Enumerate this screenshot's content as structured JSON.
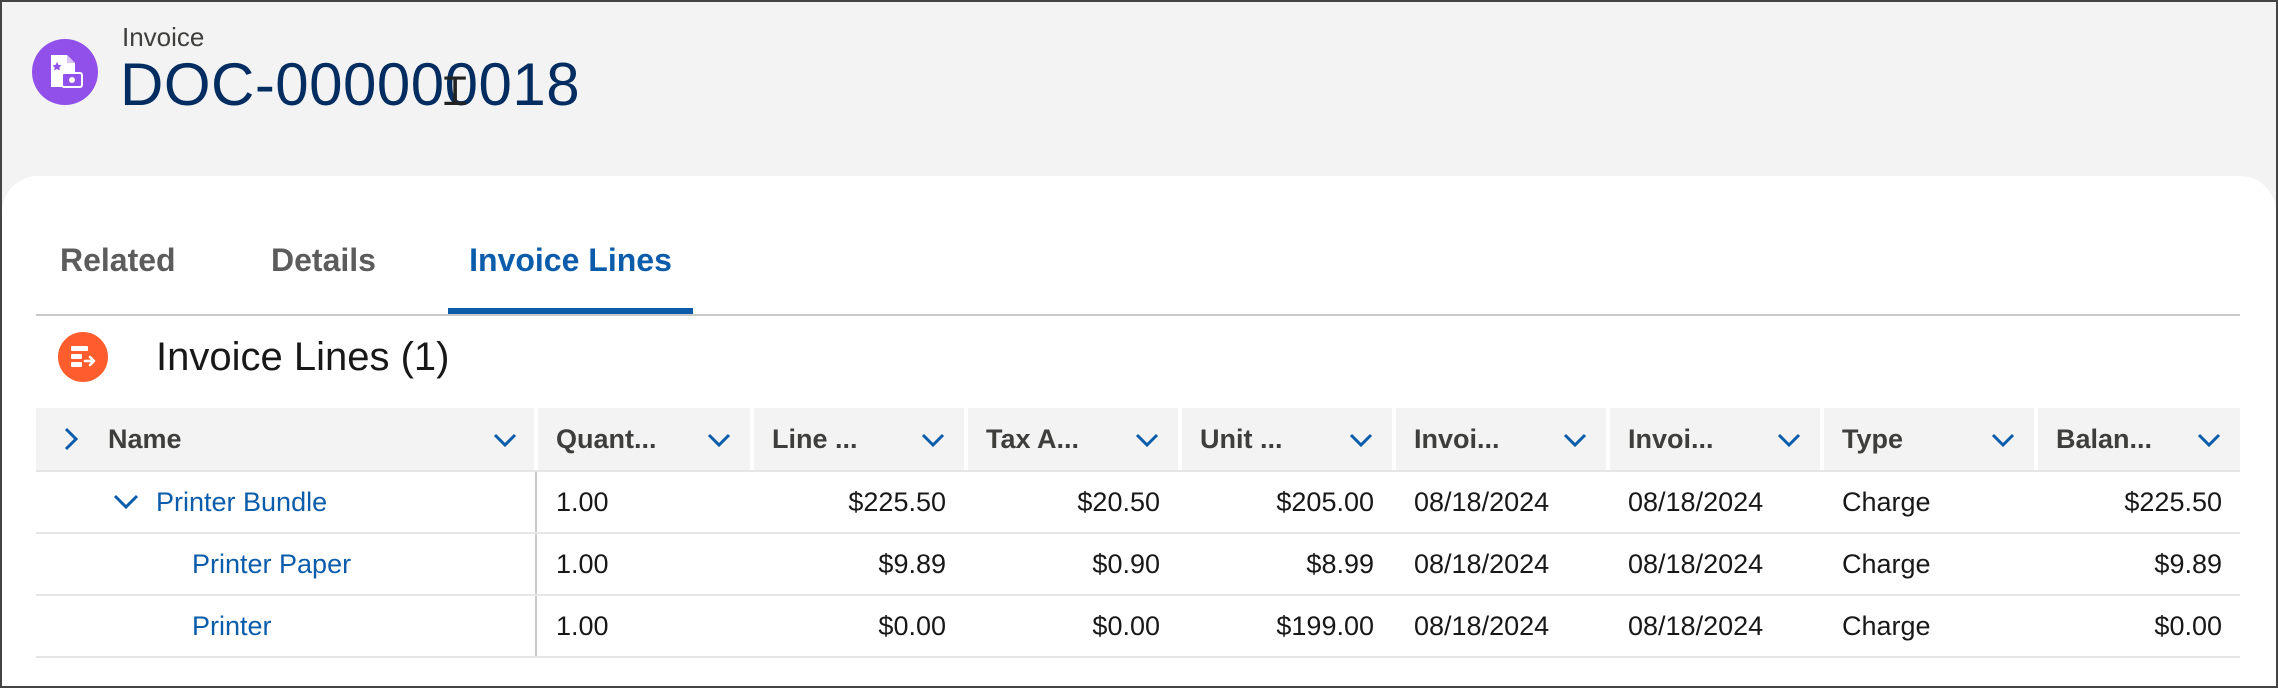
{
  "record": {
    "type_label": "Invoice",
    "title": "DOC-000000018",
    "icon": "invoice-icon",
    "icon_color": "#9050e9"
  },
  "tabs": [
    {
      "label": "Related",
      "active": false
    },
    {
      "label": "Details",
      "active": false
    },
    {
      "label": "Invoice Lines",
      "active": true
    }
  ],
  "section": {
    "title": "Invoice Lines (1)",
    "icon": "invoice-lines-icon",
    "icon_color": "#ff5d2d"
  },
  "grid": {
    "columns": [
      "Name",
      "Quant...",
      "Line ...",
      "Tax A...",
      "Unit ...",
      "Invoi...",
      "Invoi...",
      "Type",
      "Balan..."
    ],
    "rows": [
      {
        "name": "Printer Bundle",
        "expanded": true,
        "level": 1,
        "cells": [
          "1.00",
          "$225.50",
          "$20.50",
          "$205.00",
          "08/18/2024",
          "08/18/2024",
          "Charge",
          "$225.50"
        ]
      },
      {
        "name": "Printer Paper",
        "level": 2,
        "cells": [
          "1.00",
          "$9.89",
          "$0.90",
          "$8.99",
          "08/18/2024",
          "08/18/2024",
          "Charge",
          "$9.89"
        ]
      },
      {
        "name": "Printer",
        "level": 2,
        "cells": [
          "1.00",
          "$0.00",
          "$0.00",
          "$199.00",
          "08/18/2024",
          "08/18/2024",
          "Charge",
          "$0.00"
        ]
      }
    ]
  },
  "colors": {
    "accent": "#0b5cab",
    "title": "#032d60"
  }
}
